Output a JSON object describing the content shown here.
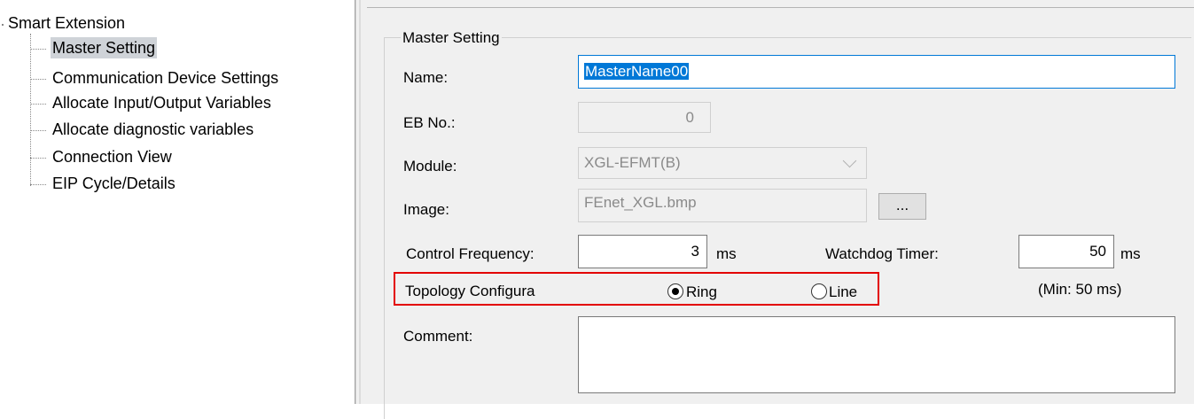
{
  "tree": {
    "root_label": "Smart Extension",
    "items": [
      {
        "label": "Master Setting",
        "selected": true
      },
      {
        "label": "Communication Device Settings",
        "selected": false
      },
      {
        "label": "Allocate Input/Output Variables",
        "selected": false
      },
      {
        "label": "Allocate diagnostic variables",
        "selected": false
      },
      {
        "label": "Connection View",
        "selected": false
      },
      {
        "label": "EIP Cycle/Details",
        "selected": false
      }
    ]
  },
  "form": {
    "group_title": "Master Setting",
    "name": {
      "label": "Name:",
      "value": "MasterName00"
    },
    "eb_no": {
      "label": "EB No.:",
      "value": "0"
    },
    "module": {
      "label": "Module:",
      "value": "XGL-EFMT(B)"
    },
    "image": {
      "label": "Image:",
      "value": "FEnet_XGL.bmp",
      "browse_label": "..."
    },
    "control_frequency": {
      "label": "Control Frequency:",
      "value": "3",
      "unit": "ms"
    },
    "watchdog_timer": {
      "label": "Watchdog Timer:",
      "value": "50",
      "unit": "ms",
      "hint": "(Min: 50 ms)"
    },
    "topology": {
      "label": "Topology Configura",
      "options": [
        {
          "label": "Ring",
          "checked": true
        },
        {
          "label": "Line",
          "checked": false
        }
      ]
    },
    "comment": {
      "label": "Comment:",
      "value": ""
    }
  },
  "colors": {
    "highlight": "#e30000",
    "selection": "#0078d7",
    "tree_selected": "#cfd3d8"
  }
}
